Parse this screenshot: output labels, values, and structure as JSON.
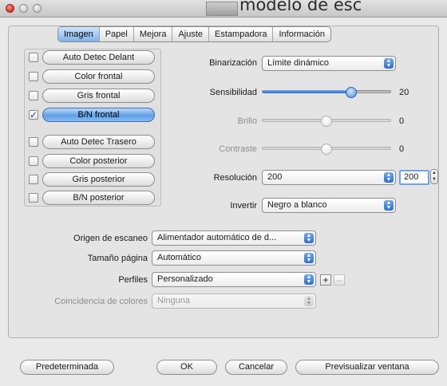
{
  "window": {
    "title_fragment": "modelo de esc"
  },
  "tabs": [
    "Imagen",
    "Papel",
    "Mejora",
    "Ajuste",
    "Estampadora",
    "Información"
  ],
  "active_tab": "Imagen",
  "image_modes": [
    {
      "label": "Auto Detec Delant",
      "checked": false,
      "selected": false
    },
    {
      "label": "Color frontal",
      "checked": false,
      "selected": false
    },
    {
      "label": "Gris frontal",
      "checked": false,
      "selected": false
    },
    {
      "label": "B/N frontal",
      "checked": true,
      "selected": true
    },
    {
      "label": "Auto Detec Trasero",
      "checked": false,
      "selected": false
    },
    {
      "label": "Color posterior",
      "checked": false,
      "selected": false
    },
    {
      "label": "Gris posterior",
      "checked": false,
      "selected": false
    },
    {
      "label": "B/N posterior",
      "checked": false,
      "selected": false
    }
  ],
  "settings": {
    "binarization": {
      "label": "Binarización",
      "value": "Límite dinámico"
    },
    "sensitivity": {
      "label": "Sensibilidad",
      "value": "20",
      "level": 0.69,
      "enabled": true
    },
    "brightness": {
      "label": "Brillo",
      "value": "0",
      "level": 0.5,
      "enabled": false
    },
    "contrast": {
      "label": "Contraste",
      "value": "0",
      "level": 0.5,
      "enabled": false
    },
    "resolution": {
      "label": "Resolución",
      "value": "200",
      "field_value": "200"
    },
    "invert": {
      "label": "Invertir",
      "value": "Negro a blanco"
    }
  },
  "scan": {
    "source": {
      "label": "Origen de escaneo",
      "value": "Alimentador automático de d..."
    },
    "page_size": {
      "label": "Tamaño página",
      "value": "Automático"
    },
    "profiles": {
      "label": "Perfiles",
      "value": "Personalizado",
      "add": "+",
      "remove": "–"
    },
    "color_matching": {
      "label": "Coincidencia de colores",
      "value": "Ninguna"
    }
  },
  "buttons": {
    "default": "Predeterminada",
    "ok": "OK",
    "cancel": "Cancelar",
    "preview": "Previsualizar ventana"
  },
  "colors": {
    "accent": "#4b8ae0",
    "selected_pill": "#5e9fe6",
    "close_light": "#d93a2b"
  }
}
